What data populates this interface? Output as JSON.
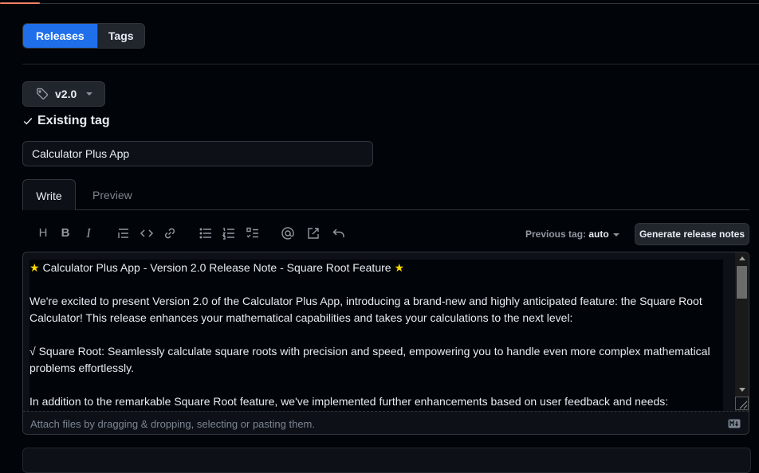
{
  "tabs": {
    "releases": "Releases",
    "tags": "Tags"
  },
  "tag_picker": {
    "value": "v2.0",
    "status": "Existing tag"
  },
  "release_title": {
    "value": "Calculator Plus App"
  },
  "editor_tabs": {
    "write": "Write",
    "preview": "Preview"
  },
  "toolbar": {
    "icons": [
      "heading-icon",
      "bold-icon",
      "italic-icon",
      "quote-icon",
      "code-icon",
      "link-icon",
      "unordered-list-icon",
      "ordered-list-icon",
      "task-list-icon",
      "mention-icon",
      "reference-icon",
      "undo-icon"
    ],
    "heading": "H",
    "bold": "B",
    "italic": "I",
    "previous_tag_label": "Previous tag:",
    "previous_tag_value": "auto",
    "generate_label": "Generate release notes"
  },
  "body": {
    "line1": "★ Calculator Plus App - Version 2.0 Release Note - Square Root Feature ★",
    "para1": "We're excited to present Version 2.0 of the Calculator Plus App, introducing a brand-new and highly anticipated feature: the Square Root Calculator! This release enhances your mathematical capabilities and takes your calculations to the next level:",
    "para2": "√ Square Root: Seamlessly calculate square roots with precision and speed, empowering you to handle even more complex mathematical problems effortlessly.",
    "para3": "In addition to the remarkable Square Root feature, we've implemented further enhancements based on user feedback and needs:"
  },
  "footer": {
    "attach_text": "Attach files by dragging & dropping, selecting or pasting them."
  },
  "colors": {
    "accent": "#1f6feb",
    "background": "#010409",
    "border": "#30363d"
  }
}
